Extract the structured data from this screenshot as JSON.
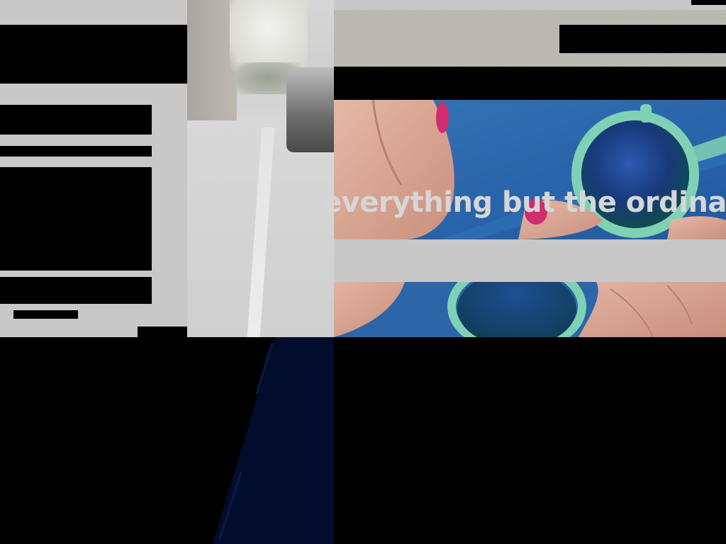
{
  "hero": {
    "tagline": "everything but the ordinary"
  },
  "colors": {
    "hero_blue": "#2f6cae",
    "panel_gray": "#c8c8c8",
    "tagline_text": "#d6d6d6",
    "sunglasses_frame": "#7fd1b4",
    "lens": "#1c3f7e",
    "nail_polish": "#d02c6e",
    "dark_navy": "#020c2c"
  },
  "icons": {
    "hero_image": "sunglasses-photo",
    "side_image": "blurred-street-photo"
  }
}
